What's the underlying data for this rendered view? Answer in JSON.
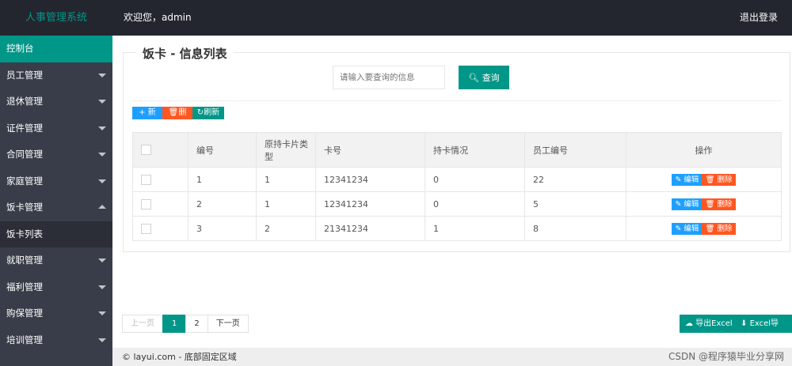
{
  "header": {
    "logo": "人事管理系统",
    "welcome": "欢迎您，admin",
    "logout": "退出登录"
  },
  "sidebar": {
    "items": [
      {
        "label": "控制台",
        "state": "active"
      },
      {
        "label": "员工管理",
        "state": "collapsed"
      },
      {
        "label": "退休管理",
        "state": "collapsed"
      },
      {
        "label": "证件管理",
        "state": "collapsed"
      },
      {
        "label": "合同管理",
        "state": "collapsed"
      },
      {
        "label": "家庭管理",
        "state": "collapsed"
      },
      {
        "label": "饭卡管理",
        "state": "expanded"
      },
      {
        "label": "饭卡列表",
        "state": "sub"
      },
      {
        "label": "就职管理",
        "state": "collapsed"
      },
      {
        "label": "福利管理",
        "state": "collapsed"
      },
      {
        "label": "购保管理",
        "state": "collapsed"
      },
      {
        "label": "培训管理",
        "state": "collapsed"
      }
    ]
  },
  "main": {
    "legend": "饭卡 - 信息列表",
    "search": {
      "placeholder": "请输入要查询的信息",
      "button": "查询"
    },
    "toolbar": {
      "add": "新增",
      "delete": "删除",
      "refresh": "刷新"
    },
    "table": {
      "headers": [
        "编号",
        "原持卡片类型",
        "卡号",
        "持卡情况",
        "员工编号",
        "操作"
      ],
      "rows": [
        {
          "id": "1",
          "type": "1",
          "card": "12341234",
          "status": "0",
          "emp": "22"
        },
        {
          "id": "2",
          "type": "1",
          "card": "12341234",
          "status": "0",
          "emp": "5"
        },
        {
          "id": "3",
          "type": "2",
          "card": "21341234",
          "status": "1",
          "emp": "8"
        }
      ],
      "edit_label": "编辑",
      "delete_label": "删除"
    },
    "pager": {
      "prev": "上一页",
      "pages": [
        "1",
        "2"
      ],
      "current": "1",
      "next": "下一页"
    },
    "export": {
      "export_excel": "导出Excel",
      "import_excel": "Excel导入"
    }
  },
  "footer": {
    "copyright": "© layui.com - 底部固定区域",
    "watermark": "CSDN @程序猿毕业分享网"
  }
}
